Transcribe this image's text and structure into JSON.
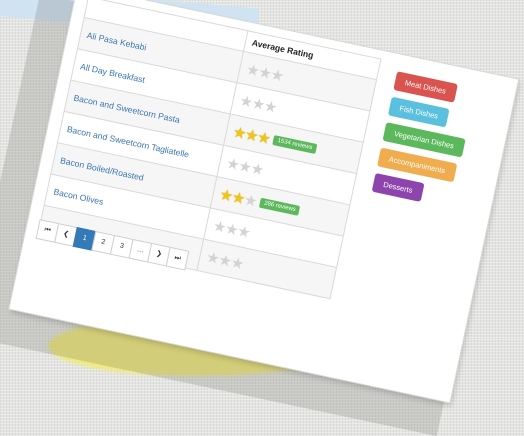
{
  "table": {
    "rating_header": "Average Rating",
    "rows": [
      {
        "name": "Ali Pasa Kebabi",
        "filled": 0,
        "reviews": ""
      },
      {
        "name": "All Day Breakfast",
        "filled": 0,
        "reviews": ""
      },
      {
        "name": "Bacon and Sweetcorn Pasta",
        "filled": 3,
        "reviews": "1534 reviews"
      },
      {
        "name": "Bacon and Sweetcorn Tagliatelle",
        "filled": 0,
        "reviews": ""
      },
      {
        "name": "Bacon Boiled/Roasted",
        "filled": 2,
        "reviews": "286 reviews"
      },
      {
        "name": "Bacon Olives",
        "filled": 0,
        "reviews": ""
      },
      {
        "name": "",
        "filled": 0,
        "reviews": ""
      }
    ]
  },
  "pagination": {
    "items": [
      "⏮",
      "❮",
      "1",
      "2",
      "3",
      "…",
      "❯",
      "⏭"
    ],
    "active": "1"
  },
  "categories": [
    {
      "label": "Meat Dishes",
      "color": "#d9534f"
    },
    {
      "label": "Fish Dishes",
      "color": "#5bc0de"
    },
    {
      "label": "Vegetarian Dishes",
      "color": "#5cb85c"
    },
    {
      "label": "Accompaniments",
      "color": "#f0ad4e"
    },
    {
      "label": "Desserts",
      "color": "#8e44ad"
    }
  ]
}
